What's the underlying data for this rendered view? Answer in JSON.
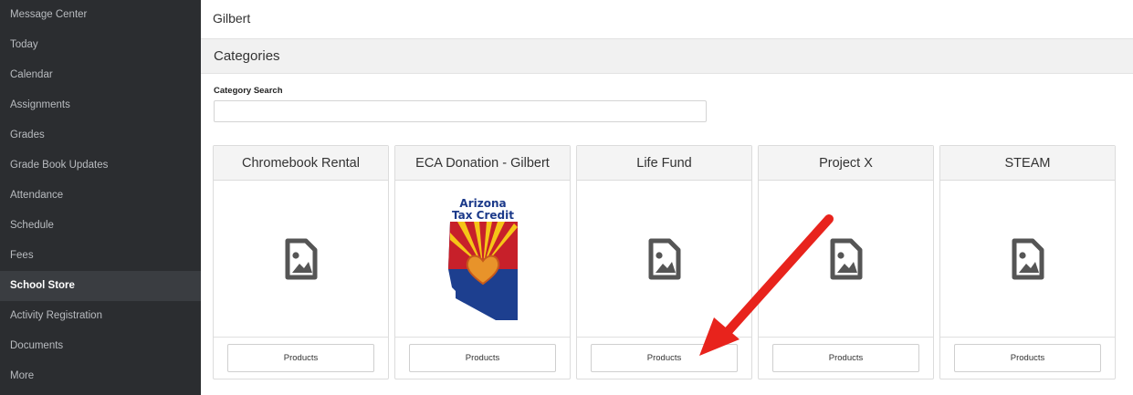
{
  "sidebar": {
    "items": [
      {
        "label": "Message Center",
        "active": false
      },
      {
        "label": "Today",
        "active": false
      },
      {
        "label": "Calendar",
        "active": false
      },
      {
        "label": "Assignments",
        "active": false
      },
      {
        "label": "Grades",
        "active": false
      },
      {
        "label": "Grade Book Updates",
        "active": false
      },
      {
        "label": "Attendance",
        "active": false
      },
      {
        "label": "Schedule",
        "active": false
      },
      {
        "label": "Fees",
        "active": false
      },
      {
        "label": "School Store",
        "active": true
      },
      {
        "label": "Activity Registration",
        "active": false
      },
      {
        "label": "Documents",
        "active": false
      },
      {
        "label": "More",
        "active": false
      }
    ]
  },
  "header": {
    "title": "Gilbert"
  },
  "categories": {
    "title": "Categories",
    "search_label": "Category Search",
    "search_value": "",
    "cards": [
      {
        "title": "Chromebook Rental",
        "image": "image-placeholder-icon",
        "button": "Products"
      },
      {
        "title": "ECA Donation - Gilbert",
        "image": "arizona-tax-credit-logo",
        "logo_line1": "Arizona",
        "logo_line2": "Tax Credit",
        "button": "Products"
      },
      {
        "title": "Life Fund",
        "image": "image-placeholder-icon",
        "button": "Products"
      },
      {
        "title": "Project X",
        "image": "image-placeholder-icon",
        "button": "Products"
      },
      {
        "title": "STEAM",
        "image": "image-placeholder-icon",
        "button": "Products"
      }
    ]
  },
  "annotation": {
    "arrow_color": "#e8231c",
    "icon": "red-arrow-annotation"
  },
  "colors": {
    "sidebar_bg": "#2b2d30",
    "sidebar_active_bg": "#3a3d41",
    "placeholder_icon": "#555555"
  }
}
